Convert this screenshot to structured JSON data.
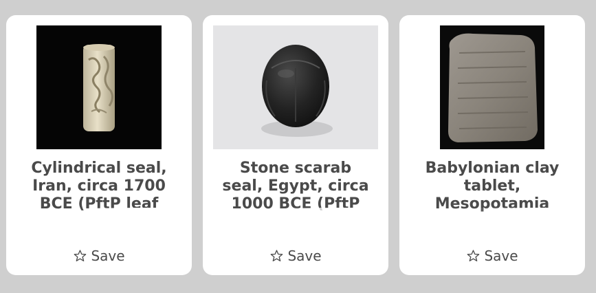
{
  "cards": [
    {
      "title": "Cylindrical seal, Iran, circa 1700 BCE (PftP leaf",
      "image_alt": "cylindrical-seal-image",
      "save_label": "Save",
      "save_icon": "star-outline-icon"
    },
    {
      "title": "Stone scarab seal, Egypt, circa 1000 BCE (PftP",
      "image_alt": "stone-scarab-seal-image",
      "save_label": "Save",
      "save_icon": "star-outline-icon"
    },
    {
      "title": "Babylonian clay tablet, Mesopotamia",
      "image_alt": "babylonian-clay-tablet-image",
      "save_label": "Save",
      "save_icon": "star-outline-icon"
    }
  ],
  "colors": {
    "page_background": "#cfcfcf",
    "card_background": "#ffffff",
    "text": "#4a4a4a"
  }
}
